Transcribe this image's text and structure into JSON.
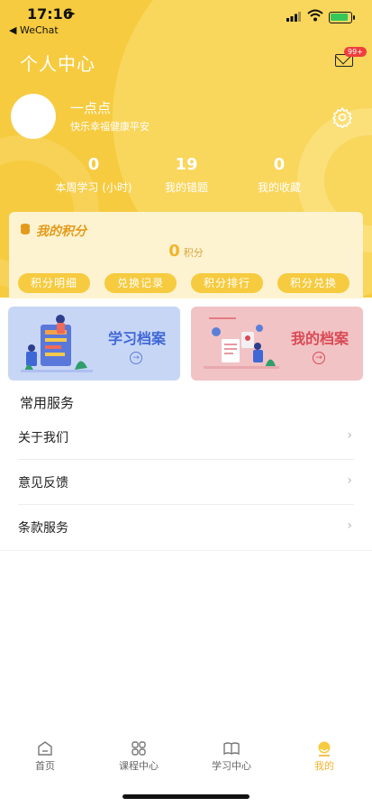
{
  "status_bar": {
    "time": "17:16",
    "back_app": "WeChat"
  },
  "header": {
    "title": "个人中心",
    "mail_badge": "99+"
  },
  "user": {
    "name": "一点点",
    "motto": "快乐幸福健康平安"
  },
  "stats": [
    {
      "value": "0",
      "label": "本周学习 (小时)"
    },
    {
      "value": "19",
      "label": "我的错题"
    },
    {
      "value": "0",
      "label": "我的收藏"
    }
  ],
  "points": {
    "title": "我的积分",
    "value": "0",
    "unit": "积分",
    "buttons": [
      "积分明细",
      "兑换记录",
      "积分排行",
      "积分兑换"
    ]
  },
  "archives": [
    {
      "title": "学习档案",
      "color": "#3f68d6"
    },
    {
      "title": "我的档案",
      "color": "#d94a55"
    }
  ],
  "services": {
    "title": "常用服务",
    "items": [
      "关于我们",
      "意见反馈",
      "条款服务"
    ]
  },
  "tabbar": {
    "items": [
      {
        "label": "首页",
        "icon": "home-icon"
      },
      {
        "label": "课程中心",
        "icon": "grid-icon"
      },
      {
        "label": "学习中心",
        "icon": "book-icon"
      },
      {
        "label": "我的",
        "icon": "profile-icon"
      }
    ],
    "active_index": 3,
    "active_color": "#f2b32a"
  },
  "colors": {
    "brand_yellow": "#f6cb3f",
    "badge_red": "#ef3e3e"
  }
}
